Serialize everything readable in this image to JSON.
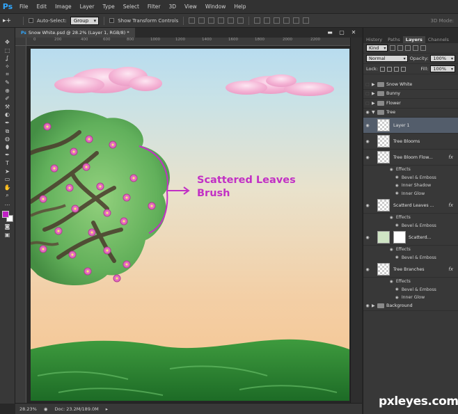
{
  "app": {
    "logo": "Ps"
  },
  "menu": [
    "File",
    "Edit",
    "Image",
    "Layer",
    "Type",
    "Select",
    "Filter",
    "3D",
    "View",
    "Window",
    "Help"
  ],
  "options": {
    "tool_glyph": "▸+",
    "auto_select_label": "Auto-Select:",
    "auto_select_value": "Group",
    "show_transform_label": "Show Transform Controls",
    "mode_3d_label": "3D Mode:"
  },
  "document": {
    "tab_icon": "Ps",
    "tab_title": "Snow White.psd @ 28.2% (Layer 1, RGB/8) *",
    "window_buttons": [
      "▬",
      "▢",
      "✕"
    ],
    "ruler_ticks": [
      "0",
      "200",
      "400",
      "600",
      "800",
      "1000",
      "1200",
      "1400",
      "1600",
      "1800",
      "2000",
      "2200"
    ]
  },
  "canvas": {
    "annotation_line1": "Scattered Leaves",
    "annotation_line2": "Brush"
  },
  "status": {
    "zoom": "28.23%",
    "doc": "Doc: 23.2M/189.0M"
  },
  "tools": [
    "✥",
    "⬚",
    "ʆ",
    "✧",
    "⌗",
    "✎",
    "⊕",
    "✐",
    "⚒",
    "◐",
    "✒",
    "⧉",
    "◍",
    "⬮",
    "✒",
    "T",
    "➤",
    "▭",
    "✋",
    "⌕",
    "…"
  ],
  "colors": {
    "foreground": "#c01ec4",
    "background": "#ffffff",
    "accent": "#31a8ff",
    "annotation": "#c230c5"
  },
  "panels": {
    "tabs": [
      "History",
      "Paths",
      "Layers",
      "Channels"
    ],
    "active_tab": "Layers",
    "kind_label": "Kind",
    "blend_mode": "Normal",
    "opacity_label": "Opacity:",
    "opacity_value": "100%",
    "lock_label": "Lock:",
    "fill_label": "Fill:",
    "fill_value": "100%"
  },
  "layers": {
    "snow_white": "Snow White",
    "bunny": "Bunny",
    "flower": "Flower",
    "tree": "Tree",
    "layer1": "Layer 1",
    "tree_blooms": "Tree Blooms",
    "tree_bloom_flow": "Tree Bloom Flow...",
    "effects": "Effects",
    "bevel_emboss": "Bevel & Emboss",
    "inner_shadow": "Inner Shadow",
    "inner_glow": "Inner Glow",
    "scatterd_leaves": "Scatterd Leaves ...",
    "scatterd": "Scatterd...",
    "tree_branches": "Tree Branches",
    "background": "Background",
    "fx": "fx"
  },
  "watermark": "pxleyes.com"
}
